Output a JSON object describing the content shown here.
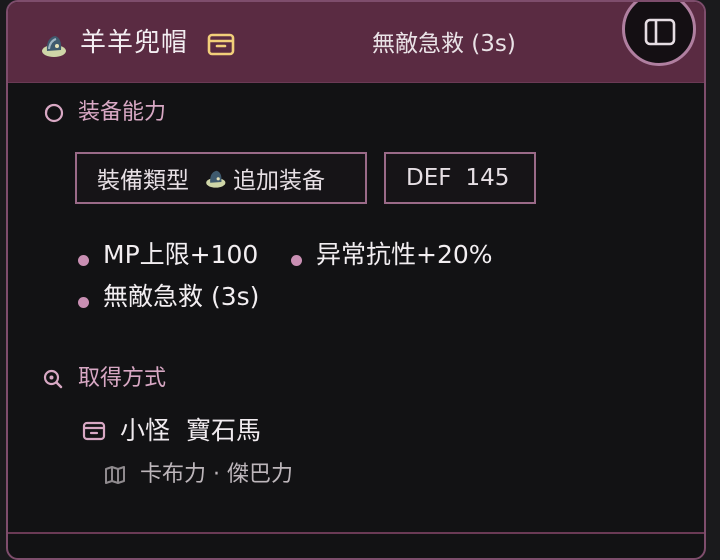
{
  "header": {
    "item_name": "羊羊兜帽",
    "effect": "無敵急救 (3s)",
    "item_icon": "hat-icon",
    "box_icon": "box-icon",
    "panel_icon": "sidebar-panel-icon"
  },
  "equipment": {
    "section_title": "装备能力",
    "section_icon": "spinner-icon",
    "type_label": "裝備類型",
    "type_value": "追加装备",
    "stat_name": "DEF",
    "stat_value": "145",
    "effects": [
      "MP上限+100",
      "异常抗性+20%",
      "無敵急救 (3s)"
    ]
  },
  "acquisition": {
    "section_title": "取得方式",
    "section_icon": "search-icon",
    "source_type": "小怪",
    "source_name": "寶石馬",
    "source_icon": "box-icon",
    "location": "卡布力 · 傑巴力",
    "location_icon": "map-icon"
  },
  "colors": {
    "accent": "#d8a8c4",
    "header_bg": "#5a2b42",
    "border": "#7e4d6c",
    "bullet": "#c98fb3"
  }
}
